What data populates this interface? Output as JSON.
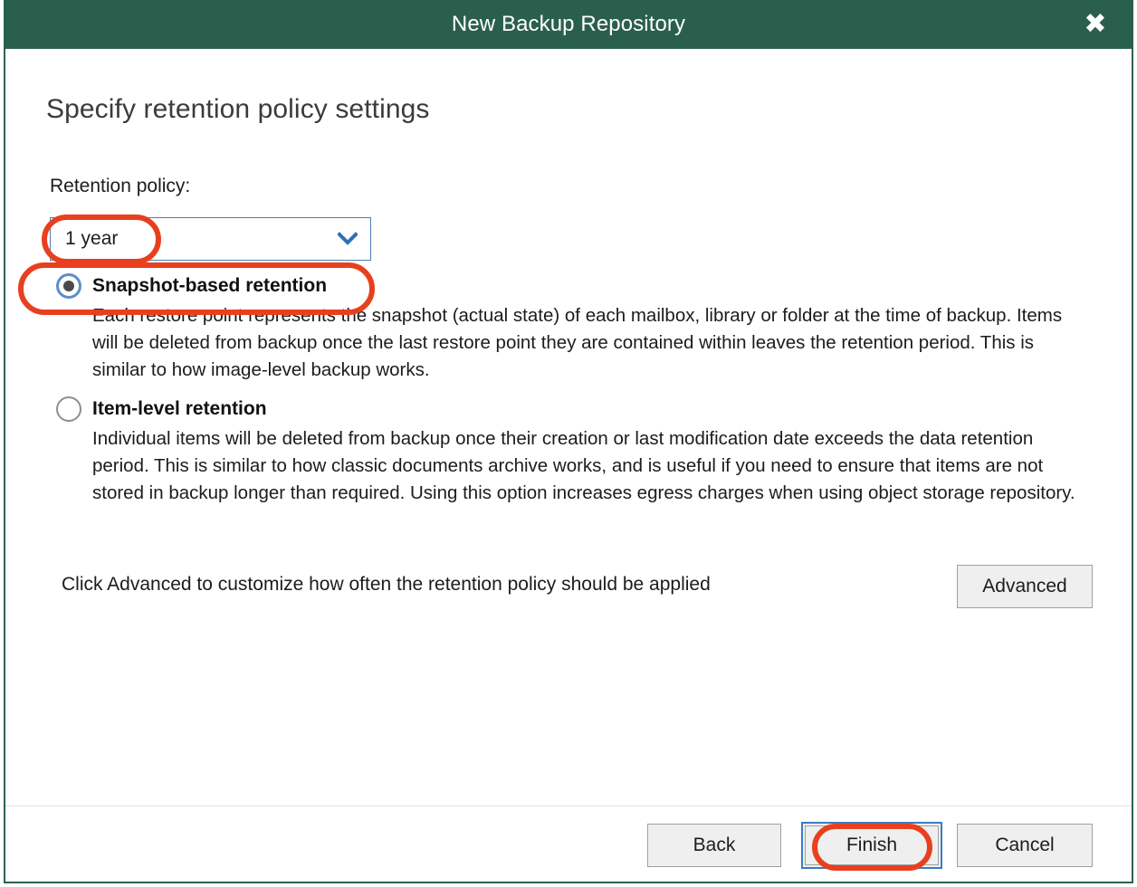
{
  "window": {
    "title": "New Backup Repository",
    "close_icon": "close-x-icon",
    "titlebar_color": "#2b5f4d",
    "border_color": "#2d6151"
  },
  "page": {
    "heading": "Specify retention policy settings"
  },
  "retention": {
    "label": "Retention policy:",
    "dropdown": {
      "value": "1 year",
      "icon": "chevron-down-icon",
      "accent_color": "#4a7fb5"
    },
    "options": [
      {
        "id": "snapshot-based",
        "title": "Snapshot-based retention",
        "description": "Each restore point represents the snapshot (actual state) of each mailbox, library or folder at the time of backup. Items will be deleted from backup once the last restore point they are contained within leaves the retention period. This is similar to how image-level backup works.",
        "selected": true
      },
      {
        "id": "item-level",
        "title": "Item-level retention",
        "description": "Individual items will be deleted from backup once their creation or last modification date exceeds the data retention period. This is similar to how classic documents archive works, and is useful if you need to ensure that items are not stored in backup longer than required. Using this option increases egress charges when using object storage repository.",
        "selected": false
      }
    ]
  },
  "advanced": {
    "hint": "Click Advanced to customize how often the retention policy should be applied",
    "button_label": "Advanced"
  },
  "footer": {
    "back_label": "Back",
    "finish_label": "Finish",
    "cancel_label": "Cancel",
    "focus_color": "#3b7cc4"
  },
  "annotations": {
    "color": "#e8401f",
    "targets": [
      "retention-dropdown-value",
      "snapshot-based-retention-option",
      "finish-button"
    ]
  }
}
